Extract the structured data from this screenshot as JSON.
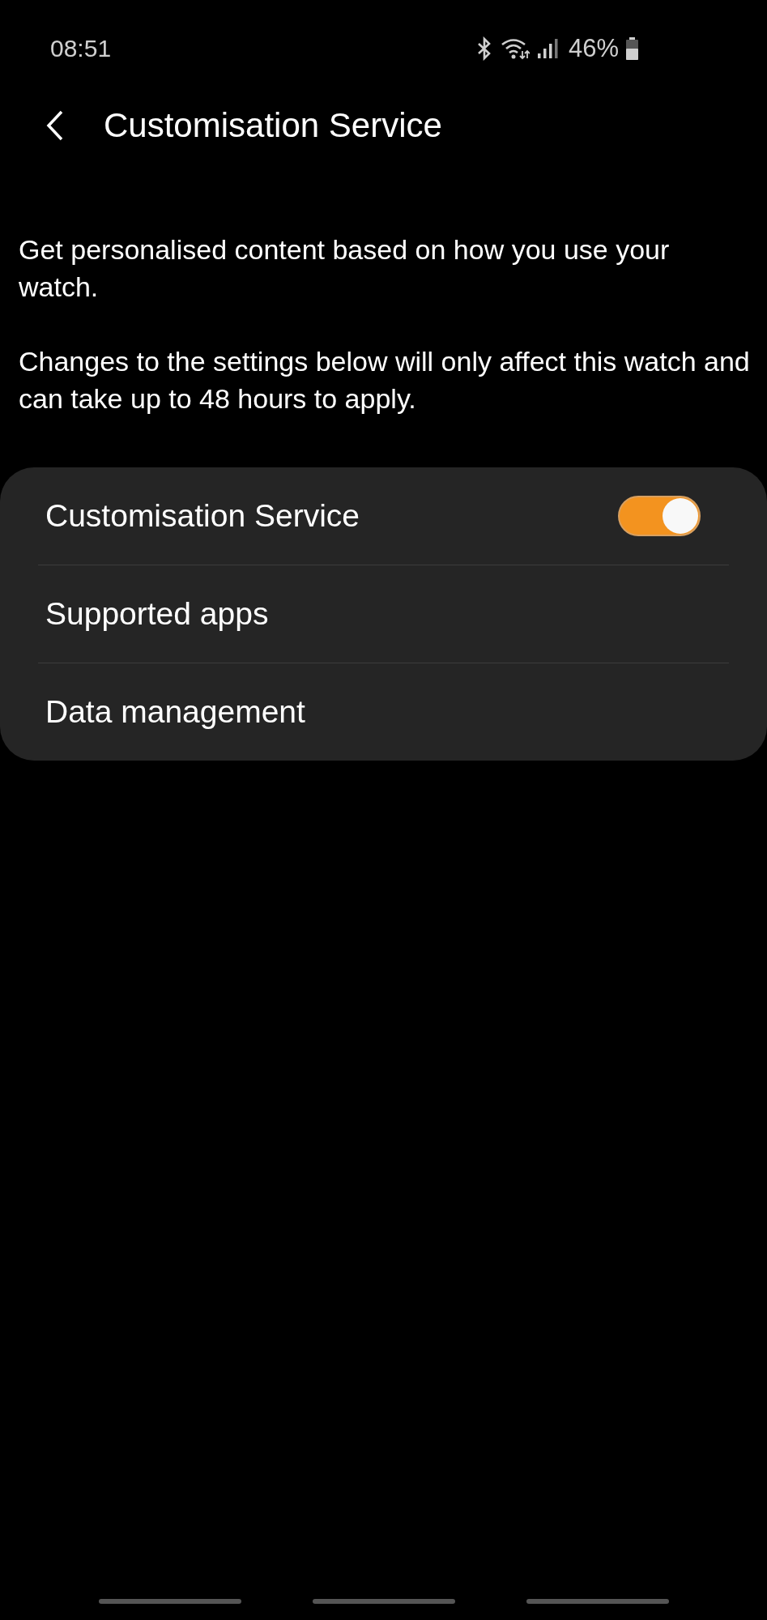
{
  "status_bar": {
    "time": "08:51",
    "battery": "46%"
  },
  "header": {
    "title": "Customisation Service"
  },
  "descriptions": [
    "Get personalised content based on how you use your watch.",
    "Changes to the settings below will only affect this watch and can take up to 48 hours to apply."
  ],
  "settings": [
    {
      "kind": "switch",
      "label": "Customisation Service",
      "on": true
    },
    {
      "kind": "link",
      "label": "Supported apps"
    },
    {
      "kind": "link",
      "label": "Data management"
    }
  ]
}
